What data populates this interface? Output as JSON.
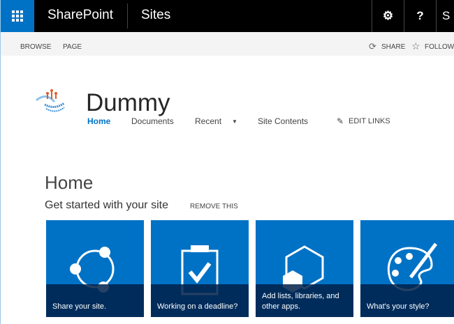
{
  "topbar": {
    "brand": "SharePoint",
    "section": "Sites",
    "settings_icon": "gear-icon",
    "help_label": "?",
    "user_initial": "S"
  },
  "ribbon": {
    "browse": "BROWSE",
    "page": "PAGE",
    "share": "SHARE",
    "follow": "FOLLOW"
  },
  "site": {
    "title": "Dummy",
    "nav": [
      "Home",
      "Documents",
      "Recent",
      "Site Contents"
    ],
    "edit_links": "EDIT LINKS",
    "active_color": "#0072c6"
  },
  "main": {
    "heading": "Home",
    "getting_started": "Get started with your site",
    "remove": "REMOVE THIS",
    "tiles": [
      {
        "label": "Share your site.",
        "icon": "share-icon"
      },
      {
        "label": "Working on a deadline?",
        "icon": "clipboard-check-icon"
      },
      {
        "label": "Add lists, libraries, and other apps.",
        "icon": "hexagon-app-icon"
      },
      {
        "label": "What's your style?",
        "icon": "palette-icon"
      }
    ]
  },
  "colors": {
    "tile": "#0072c6",
    "topbar": "#000000"
  }
}
